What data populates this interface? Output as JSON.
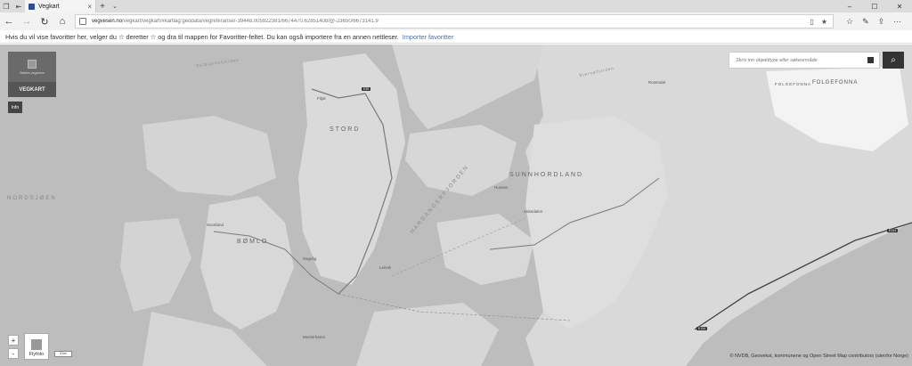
{
  "browser": {
    "tab_title": "Vegkart",
    "url_host": "vegvesen.no",
    "url_path": "/vegkart/vegkart/#kartlag:geodata/vegreferanse/-39448.005922381/6674470.62851408/@-23650/6673141.9",
    "favorites_hint": "Hvis du vil vise favoritter her, velger du  ☆  deretter ☆ og dra til mappen for Favoritter-feltet. Du kan også importere fra en annen nettleser.",
    "import_link": "Importer favoritter"
  },
  "app": {
    "logo_org": "Statens vegvesen",
    "logo_name": "VEGKART",
    "info_label": "Info",
    "search_placeholder": "Skriv inn objekttype eller søkeområde",
    "zoom_in": "+",
    "zoom_out": "-",
    "flyfoto_label": "Flyfoto",
    "scale_label": "5 km",
    "copyright": "© NVDB, Geovekst, kommunene og Open Street Map contributors (utenfor Norge)"
  },
  "map_labels": {
    "nordsjoen": "NORDSJØEN",
    "stord": "STORD",
    "sunnhordland": "SUNNHORDLAND",
    "bomlo": "BØMLO",
    "hardangerfjorden": "HARDANGERFJORDEN",
    "folgefonna": "FOLGEFONNA",
    "folgefonna_small": "FOLGEFONNA",
    "selbjornsfjorden": "Selbjørnsfjorden",
    "bjornafjorden": "Bjørnafjorden",
    "fitjar": "Fitjar",
    "leirvik": "Leirvik",
    "husnes": "Husnes",
    "rosendal": "Rosendal",
    "svortland": "Svortland",
    "sagvag": "Sagvåg",
    "mosterhamn": "Mosterhamn",
    "uskedalen": "Uskedalen"
  },
  "route_markers": [
    "E39",
    "E134",
    "E134"
  ],
  "colors": {
    "land": "#d9d9d9",
    "sea": "#bdbdbd",
    "road": "#7a7a7a",
    "glacier": "#f3f3f3"
  }
}
